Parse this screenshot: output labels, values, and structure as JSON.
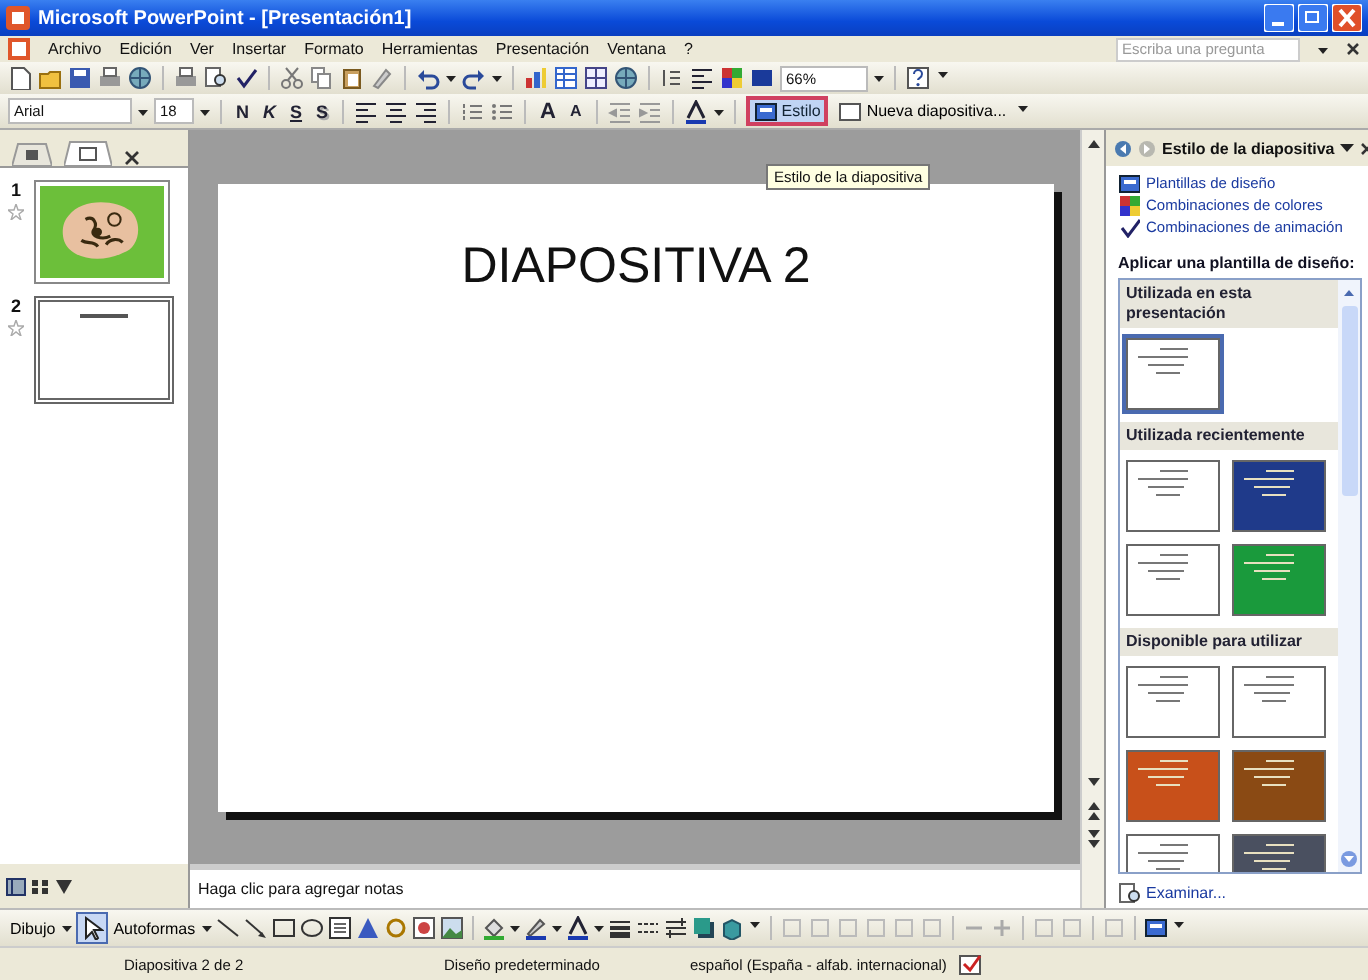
{
  "window": {
    "title": "Microsoft PowerPoint - [Presentación1]"
  },
  "menu": [
    "Archivo",
    "Edición",
    "Ver",
    "Insertar",
    "Formato",
    "Herramientas",
    "Presentación",
    "Ventana",
    "?"
  ],
  "help_box": {
    "placeholder": "Escriba una pregunta"
  },
  "standard_toolbar": {
    "zoom": "66%"
  },
  "formatting_toolbar": {
    "font": "Arial",
    "size": "18",
    "format_buttons": [
      "N",
      "K",
      "S",
      "S"
    ],
    "font_size_buttons": [
      "A",
      "A"
    ],
    "style_button": {
      "label": "Estilo",
      "selected": true
    },
    "new_slide_button": "Nueva diapositiva..."
  },
  "tooltip": "Estilo de la diapositiva",
  "slides_panel": {
    "slides": [
      {
        "number": "1",
        "kind": "picture",
        "selected": false
      },
      {
        "number": "2",
        "kind": "title",
        "selected": true
      }
    ]
  },
  "slide": {
    "title": "DIAPOSITIVA 2"
  },
  "notes": {
    "placeholder": "Haga clic para agregar notas"
  },
  "task_pane": {
    "title": "Estilo de la diapositiva",
    "links": [
      "Plantillas de diseño",
      "Combinaciones de colores",
      "Combinaciones de animación"
    ],
    "heading": "Aplicar una plantilla de diseño:",
    "sections": [
      {
        "title": "Utilizada en esta presentación",
        "templates": [
          {
            "color": "#ffffff",
            "selected": true
          }
        ]
      },
      {
        "title": "Utilizada recientemente",
        "templates": [
          {
            "color": "#ffffff",
            "selected": false
          },
          {
            "color": "#1f3a8a",
            "selected": false
          },
          {
            "color": "#ffffff",
            "selected": false
          },
          {
            "color": "#1a9a3c",
            "selected": false
          }
        ]
      },
      {
        "title": "Disponible para utilizar",
        "templates": [
          {
            "color": "#ffffff",
            "selected": false
          },
          {
            "color": "#ffffff",
            "selected": false
          },
          {
            "color": "#c8501a",
            "selected": false
          },
          {
            "color": "#8a4a14",
            "selected": false
          },
          {
            "color": "#ffffff",
            "selected": false
          },
          {
            "color": "#4a5060",
            "selected": false
          }
        ]
      }
    ],
    "browse_link": "Examinar..."
  },
  "drawing_toolbar": {
    "draw_menu": "Dibujo",
    "autoshapes_menu": "Autoformas"
  },
  "status_bar": [
    "Diapositiva 2 de 2",
    "Diseño predeterminado",
    "español (España - alfab. internacional)"
  ]
}
